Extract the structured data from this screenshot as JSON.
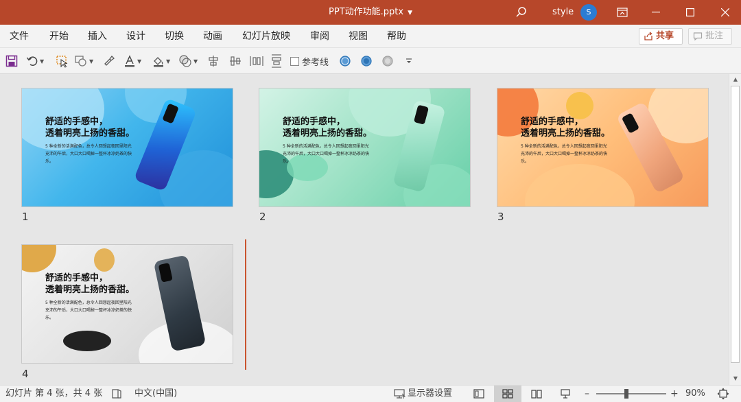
{
  "titlebar": {
    "doc_title": "PPT动作功能.pptx",
    "user_name": "style",
    "avatar_initial": "S"
  },
  "menu": {
    "items": [
      "文件",
      "开始",
      "插入",
      "设计",
      "切换",
      "动画",
      "幻灯片放映",
      "审阅",
      "视图",
      "帮助"
    ],
    "share_label": "共享",
    "comment_label": "批注"
  },
  "toolbar": {
    "guides_label": "参考线"
  },
  "slides": [
    {
      "number": "1",
      "heading_line1": "舒适的手感中，",
      "heading_line2": "透着明亮上扬的香甜。",
      "body": "5 种全新的活满配色，总令人回想起夜回里阳光充沛的午后，大口大口喝掉一整杯冰凉奶茶的快乐。"
    },
    {
      "number": "2",
      "heading_line1": "舒适的手感中，",
      "heading_line2": "透着明亮上扬的香甜。",
      "body": "5 种全新的活满配色，总令人回想起夜回里阳光充沛的午后，大口大口喝掉一整杯冰凉奶茶的快乐。"
    },
    {
      "number": "3",
      "heading_line1": "舒适的手感中，",
      "heading_line2": "透着明亮上扬的香甜。",
      "body": "5 种全新的活满配色，总令人回想起夜回里阳光充沛的午后，大口大口喝掉一整杯冰凉奶茶的快乐。"
    },
    {
      "number": "4",
      "heading_line1": "舒适的手感中，",
      "heading_line2": "透着明亮上扬的香甜。",
      "body": "5 种全新的活满配色，总令人回想起夜回里阳光充沛的午后，大口大口喝掉一整杯冰凉奶茶的快乐。"
    }
  ],
  "statusbar": {
    "slide_info": "幻灯片 第 4 张，共 4 张",
    "language": "中文(中国)",
    "display_settings": "显示器设置",
    "zoom_minus": "–",
    "zoom_plus": "+",
    "zoom_level": "90%"
  },
  "colors": {
    "accent": "#b7472a",
    "avatar": "#2b7cd3",
    "insert_marker": "#c9542e"
  }
}
